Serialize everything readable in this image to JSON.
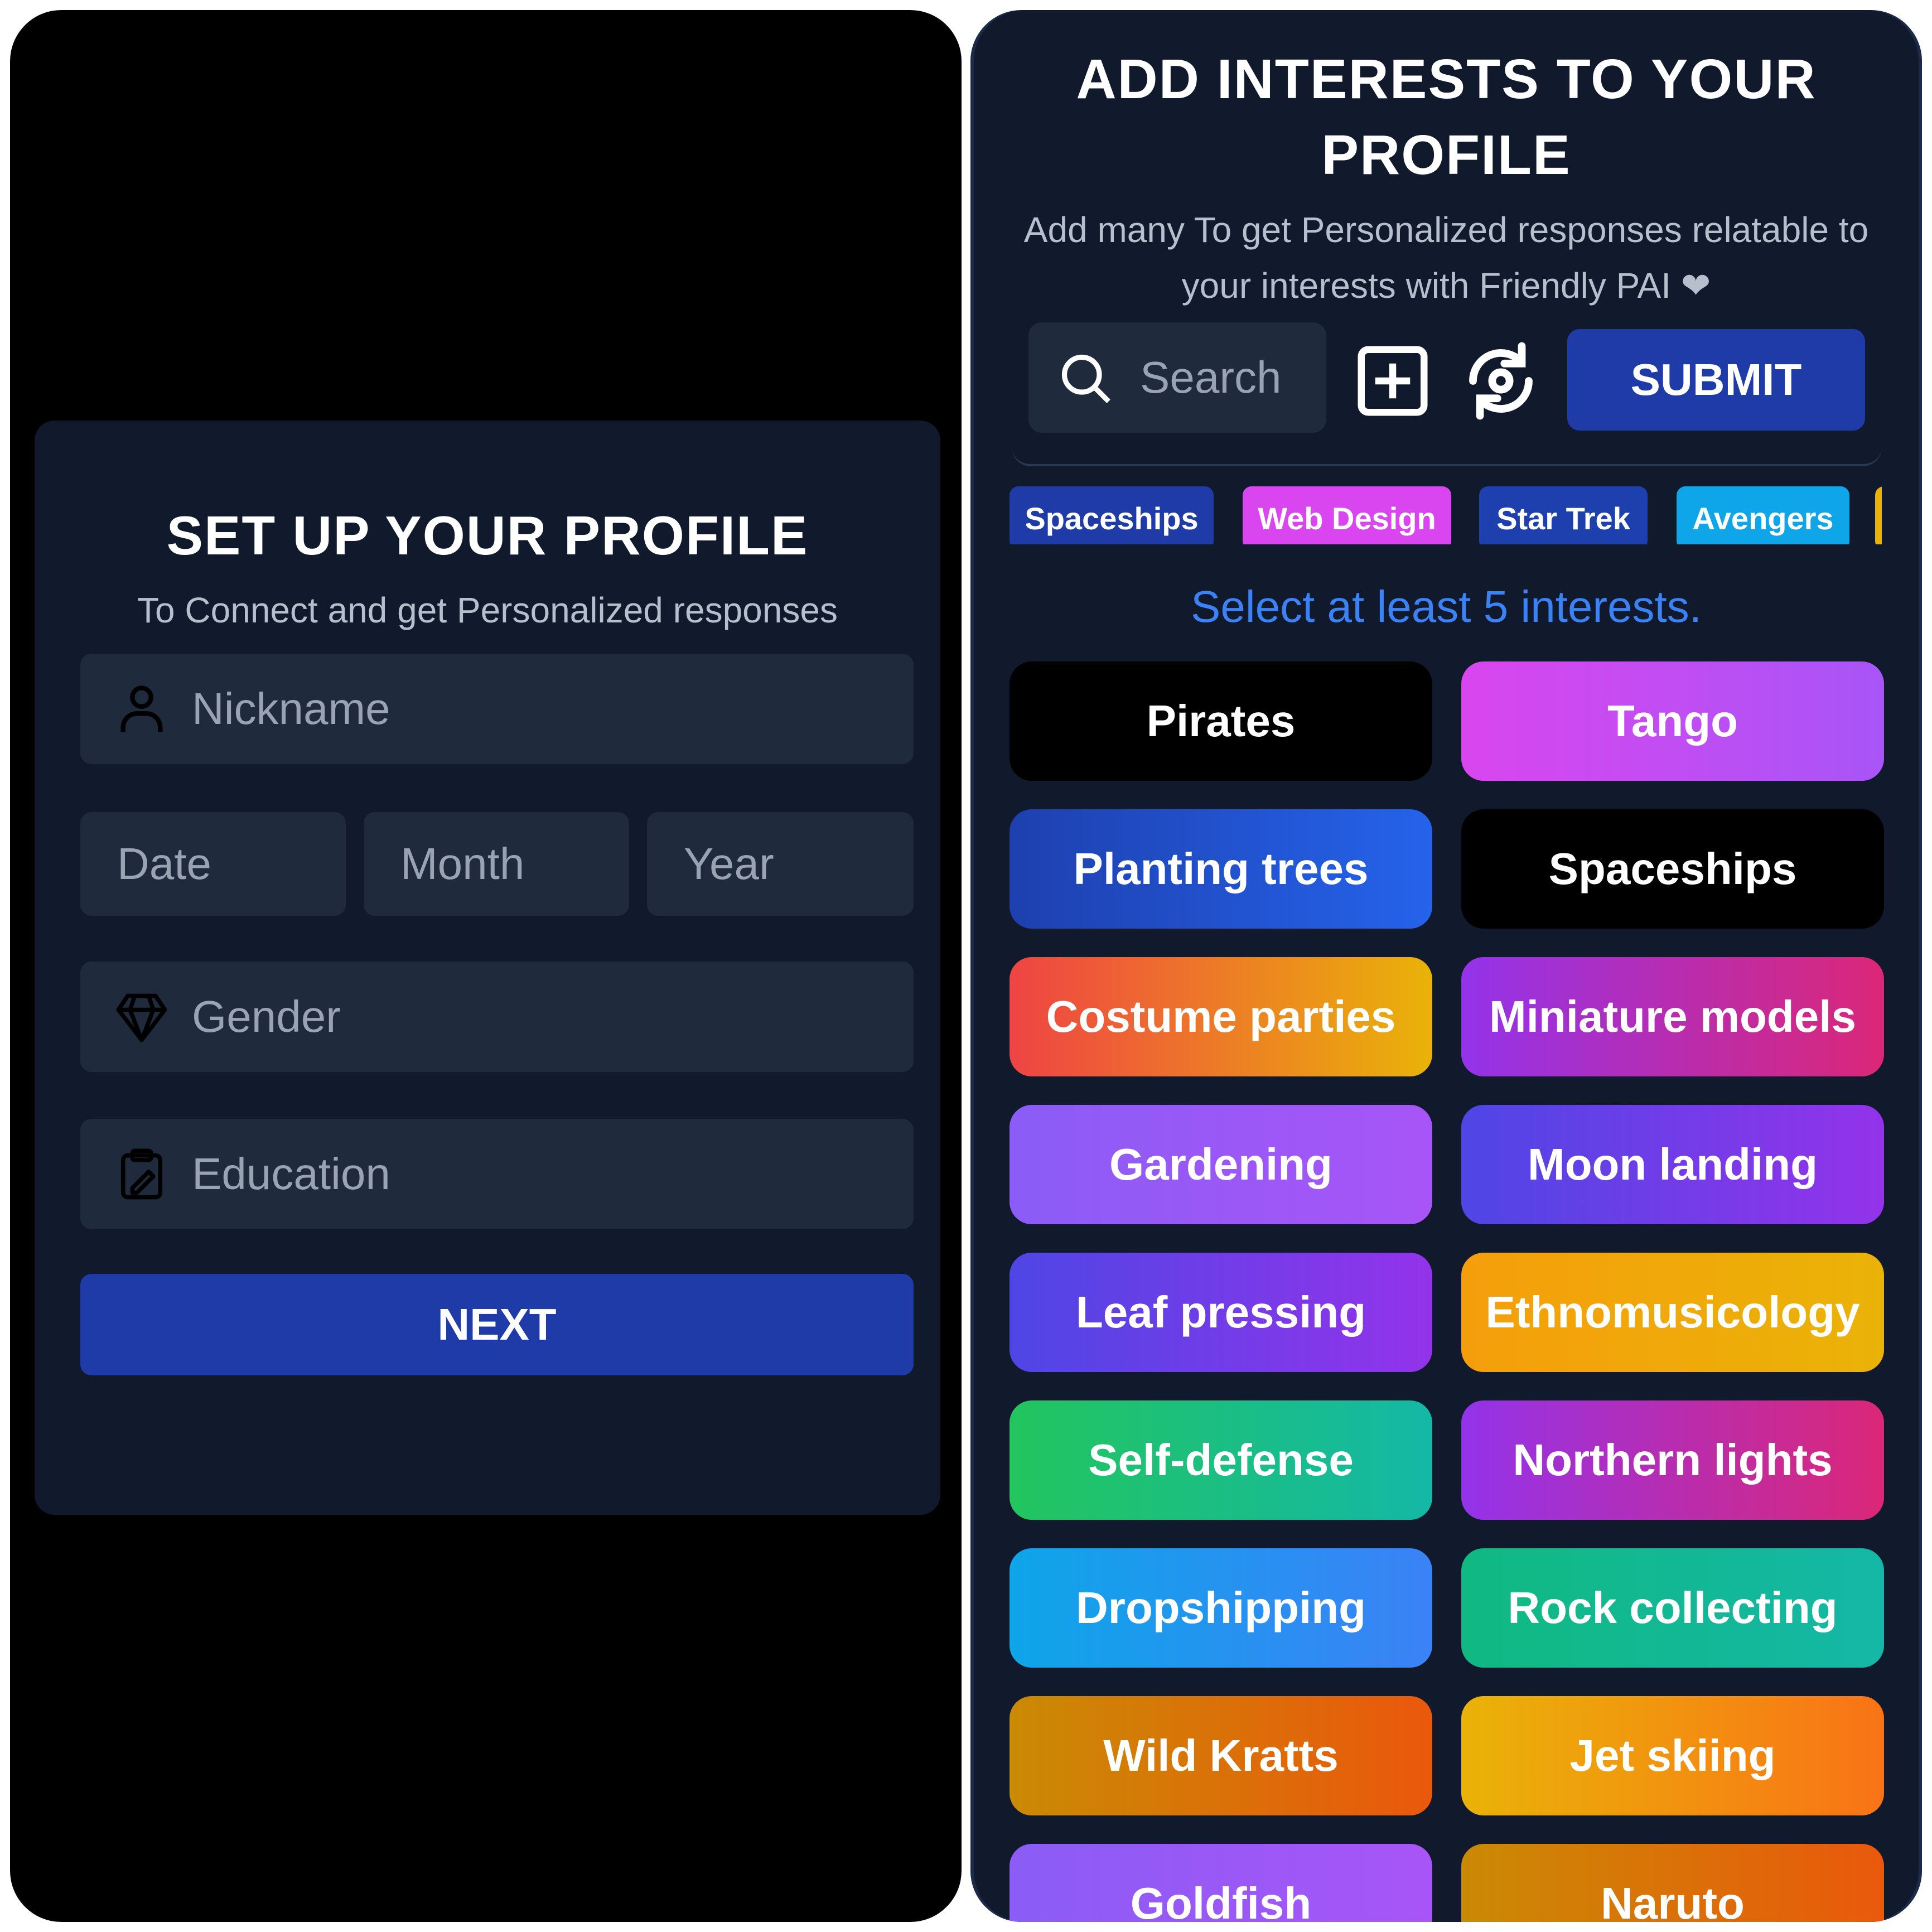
{
  "setup": {
    "title": "SET UP YOUR PROFILE",
    "subtitle": "To Connect and get Personalized responses",
    "nickname_placeholder": "Nickname",
    "date_placeholder": "Date",
    "month_placeholder": "Month",
    "year_placeholder": "Year",
    "gender_placeholder": "Gender",
    "education_placeholder": "Education",
    "next_label": "NEXT",
    "accent_color": "#1e3ba8"
  },
  "interests": {
    "title": "ADD INTERESTS TO YOUR PROFILE",
    "subtitle": "Add many To get Personalized responses relatable to your interests with Friendly PAI ❤",
    "search_placeholder": "Search",
    "submit_label": "SUBMIT",
    "hint": "Select at least 5 interests.",
    "selected_chips": [
      {
        "label": "Spaceships",
        "color": "#1e3ba8"
      },
      {
        "label": "Web Design",
        "color": "#d946ef"
      },
      {
        "label": "Star Trek",
        "color": "#1e40af"
      },
      {
        "label": "Avengers",
        "color": "#0ea5e9"
      }
    ],
    "grid": [
      {
        "label": "Pirates",
        "bg": "#000000"
      },
      {
        "label": "Tango",
        "bg": "linear-gradient(90deg,#d946ef,#a855f7)"
      },
      {
        "label": "Planting trees",
        "bg": "linear-gradient(90deg,#1e40af,#2563eb)"
      },
      {
        "label": "Spaceships",
        "bg": "#000000"
      },
      {
        "label": "Costume parties",
        "bg": "linear-gradient(90deg,#ef4444,#eab308)"
      },
      {
        "label": "Miniature models",
        "bg": "linear-gradient(90deg,#9333ea,#db2777)"
      },
      {
        "label": "Gardening",
        "bg": "linear-gradient(90deg,#8b5cf6,#a855f7)"
      },
      {
        "label": "Moon landing",
        "bg": "linear-gradient(90deg,#4f46e5,#9333ea)"
      },
      {
        "label": "Leaf pressing",
        "bg": "linear-gradient(90deg,#4f46e5,#9333ea)"
      },
      {
        "label": "Ethnomusicology",
        "bg": "linear-gradient(90deg,#f59e0b,#eab308)"
      },
      {
        "label": "Self-defense",
        "bg": "linear-gradient(90deg,#22c55e,#14b8a6)"
      },
      {
        "label": "Northern lights",
        "bg": "linear-gradient(90deg,#9333ea,#db2777)"
      },
      {
        "label": "Dropshipping",
        "bg": "linear-gradient(90deg,#0ea5e9,#3b82f6)"
      },
      {
        "label": "Rock collecting",
        "bg": "linear-gradient(90deg,#10b981,#14b8a6)"
      },
      {
        "label": "Wild Kratts",
        "bg": "linear-gradient(90deg,#ca8a04,#ea580c)"
      },
      {
        "label": "Jet skiing",
        "bg": "linear-gradient(90deg,#eab308,#f97316)"
      },
      {
        "label": "Goldfish",
        "bg": "linear-gradient(90deg,#8b5cf6,#a855f7)"
      },
      {
        "label": "Naruto",
        "bg": "linear-gradient(90deg,#ca8a04,#ea580c)"
      }
    ]
  }
}
